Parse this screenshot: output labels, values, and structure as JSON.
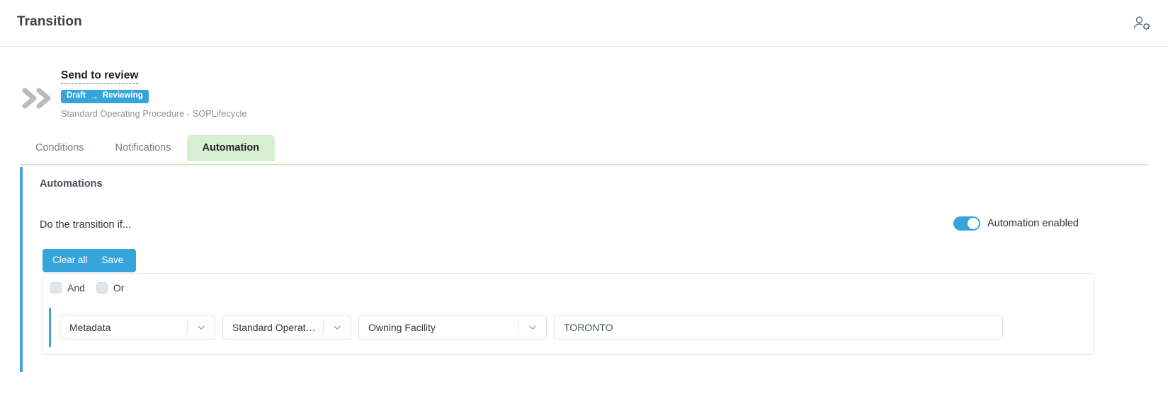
{
  "topbar": {
    "title": "Transition",
    "user_settings_icon": "user-gear-icon"
  },
  "transition": {
    "chevrons_icon": "double-chevron-right-icon",
    "name": "Send to review",
    "badge": {
      "from_state": "Draft",
      "arrow": "→",
      "to_state": "Reviewing"
    },
    "subtitle": "Standard Operating Procedure - SOPLifecycle"
  },
  "tabs": [
    {
      "label": "Conditions",
      "active": false
    },
    {
      "label": "Notifications",
      "active": false
    },
    {
      "label": "Automation",
      "active": true
    }
  ],
  "panel": {
    "title": "Automations",
    "do_transition_label": "Do the transition if...",
    "toggle": {
      "label": "Automation enabled",
      "enabled": true
    },
    "buttons": {
      "clear_all": "Clear all",
      "save": "Save"
    },
    "logic": {
      "and_label": "And",
      "or_label": "Or",
      "and_checked": false,
      "or_checked": false
    },
    "condition": {
      "source": "Metadata",
      "document_type": "Standard Operatin...",
      "attribute": "Owning Facility",
      "value": "TORONTO",
      "value_placeholder": ""
    }
  },
  "colors": {
    "accent_blue": "#35a4dd",
    "panel_border_blue": "#4a9fd8",
    "active_tab_green": "#d7eed2",
    "tab_underline_green": "#cfe8c8",
    "title_gray": "#3c4043",
    "muted_gray": "#8b9097"
  }
}
